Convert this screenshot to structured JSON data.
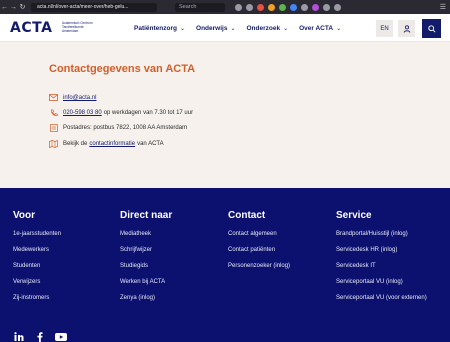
{
  "browser": {
    "url": "acta.nl/nl/over-acta/meer-over/heb-gelu...",
    "search_placeholder": "Search"
  },
  "header": {
    "logo_text": "ACTA",
    "logo_subtitle": "Academisch Centrum Tandheelkunde Amsterdam",
    "nav": [
      {
        "label": "Patiëntenzorg"
      },
      {
        "label": "Onderwijs"
      },
      {
        "label": "Onderzoek"
      },
      {
        "label": "Over ACTA"
      }
    ],
    "language": "EN"
  },
  "contact": {
    "title": "Contactgegevens van ACTA",
    "email": "info@acta.nl",
    "phone_number": "020-598 03 80",
    "phone_suffix": "op werkdagen van 7.30 tot 17 uur",
    "postal": "Postadres: postbus 7822, 1008 AA Amsterdam",
    "info_prefix": "Bekijk de",
    "info_link": "contactinformatie",
    "info_suffix": "van ACTA"
  },
  "footer": {
    "columns": [
      {
        "title": "Voor",
        "links": [
          "1e-jaarsstudenten",
          "Medewerkers",
          "Studenten",
          "Verwijzers",
          "Zij-instromers"
        ]
      },
      {
        "title": "Direct naar",
        "links": [
          "Mediatheek",
          "Schrijfwijzer",
          "Studiegids",
          "Werken bij ACTA",
          "Zenya (inlog)"
        ]
      },
      {
        "title": "Contact",
        "links": [
          "Contact algemeen",
          "Contact patiënten",
          "Personenzoeker (inlog)"
        ]
      },
      {
        "title": "Service",
        "links": [
          "Brandportal/Huisstijl (inlog)",
          "Servicedesk HR (inlog)",
          "Servicedesk IT",
          "Serviceportaal VU (inlog)",
          "Serviceportaal VU (voor externen)"
        ]
      }
    ],
    "social": [
      "linkedin-icon",
      "facebook-icon",
      "youtube-icon"
    ]
  },
  "colors": {
    "brand_navy": "#131b6b",
    "footer_bg": "#0c1170",
    "accent_orange": "#d0602b",
    "page_bg": "#f6f1ec"
  }
}
